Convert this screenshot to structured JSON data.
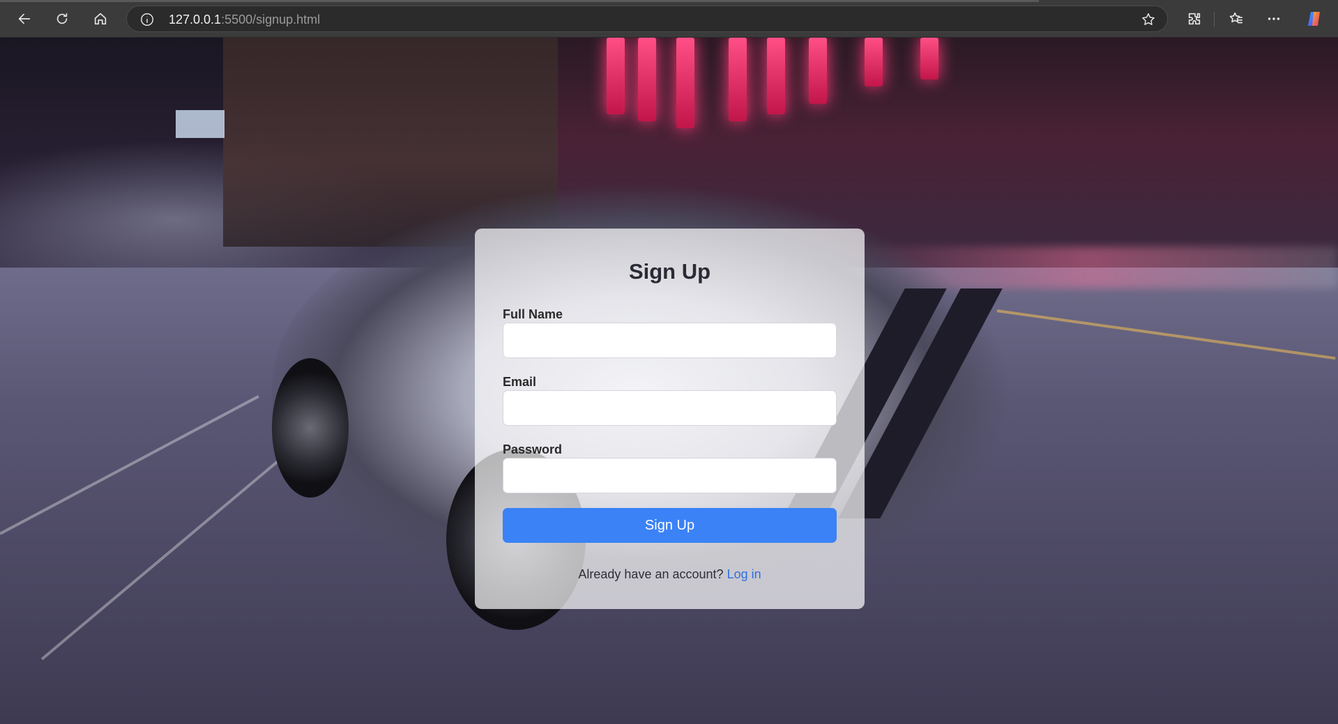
{
  "browser": {
    "url_host": "127.0.0.1",
    "url_rest": ":5500/signup.html",
    "icons": [
      "back-icon",
      "refresh-icon",
      "home-icon",
      "info-icon",
      "favorite-star-icon",
      "extensions-icon",
      "favorites-icon",
      "more-icon",
      "copilot-icon"
    ]
  },
  "signup": {
    "title": "Sign Up",
    "full_name_label": "Full Name",
    "full_name_value": "",
    "email_label": "Email",
    "email_value": "",
    "password_label": "Password",
    "password_value": "",
    "submit_label": "Sign Up",
    "footer_prompt": "Already have an account?",
    "login_link": "Log in"
  },
  "colors": {
    "accent": "#3b82f6",
    "link": "#2f6fe0",
    "browser_bar": "#3b3b3b"
  }
}
